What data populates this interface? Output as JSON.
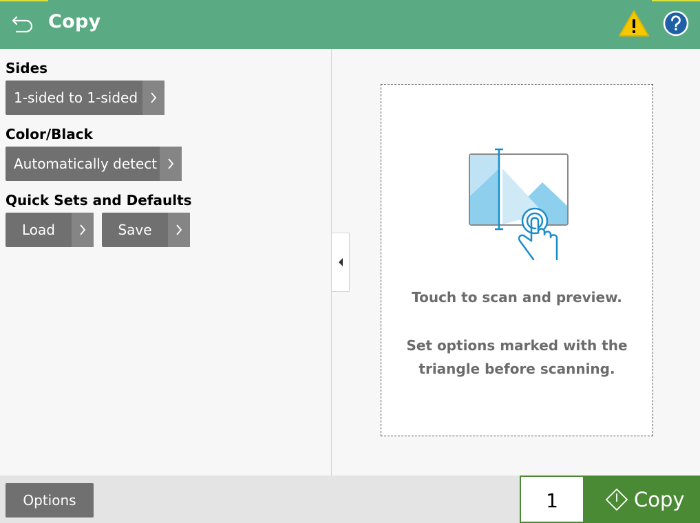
{
  "header": {
    "title": "Copy",
    "back_icon": "back-arrow-icon",
    "warning_icon": "warning-icon",
    "help_icon": "help-icon",
    "colors": {
      "bar": "#5aab83",
      "accent": "#d8e23a"
    }
  },
  "left": {
    "sides": {
      "label": "Sides",
      "value": "1-sided to 1-sided"
    },
    "color": {
      "label": "Color/Black",
      "value": "Automatically detect"
    },
    "quick_sets": {
      "label": "Quick Sets and Defaults",
      "load": "Load",
      "save": "Save"
    }
  },
  "preview": {
    "line1": "Touch to scan and preview.",
    "line2a": "Set options marked with the",
    "line2b": "triangle before scanning."
  },
  "footer": {
    "options": "Options",
    "copies": "1",
    "copy_label": "Copy",
    "copy_color": "#4b8a35"
  }
}
